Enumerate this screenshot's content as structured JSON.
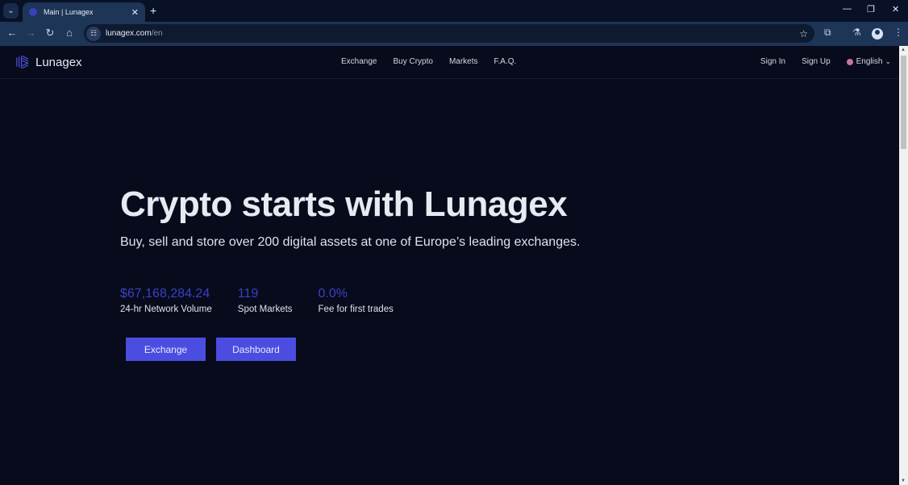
{
  "browser": {
    "tab_title": "Main | Lunagex",
    "url_host": "lunagex.com",
    "url_path": "/en",
    "icons": {
      "tab_search": "chevron-down-icon",
      "tab_close": "close-icon",
      "new_tab": "plus-icon",
      "minimize": "minimize-icon",
      "restore": "restore-icon",
      "close_window": "close-icon",
      "back": "arrow-left-icon",
      "forward": "arrow-right-icon",
      "reload": "reload-icon",
      "home": "home-icon",
      "site_info": "tune-icon",
      "bookmark": "star-icon",
      "extensions": "puzzle-icon",
      "labs": "flask-icon",
      "profile": "avatar-icon",
      "menu": "kebab-menu-icon"
    },
    "glyphs": {
      "tab_search": "⌄",
      "tab_close": "✕",
      "new_tab": "+",
      "minimize": "—",
      "restore": "❐",
      "close_window": "✕",
      "back": "←",
      "forward": "→",
      "reload": "↻",
      "home": "⌂",
      "site_info": "☷",
      "bookmark": "☆",
      "extensions": "⧉",
      "labs": "⚗",
      "menu": "⋮"
    }
  },
  "site": {
    "logo_text": "Lunagex",
    "nav": [
      "Exchange",
      "Buy Crypto",
      "Markets",
      "F.A.Q."
    ],
    "sign_in": "Sign In",
    "sign_up": "Sign Up",
    "language": "English",
    "language_chevron": "⌄"
  },
  "hero": {
    "title": "Crypto starts with Lunagex",
    "subtitle": "Buy, sell and store over 200 digital assets at one of Europe’s leading exchanges.",
    "stats": [
      {
        "value": "$67,168,284.24",
        "label": "24-hr Network Volume"
      },
      {
        "value": "119",
        "label": "Spot Markets"
      },
      {
        "value": "0.0%",
        "label": "Fee for first trades"
      }
    ],
    "buttons": {
      "exchange": "Exchange",
      "dashboard": "Dashboard"
    }
  },
  "colors": {
    "background": "#070b1c",
    "accent": "#4a4de0",
    "stat_value": "#3c40c6",
    "browser_toolbar": "#1d3557"
  }
}
